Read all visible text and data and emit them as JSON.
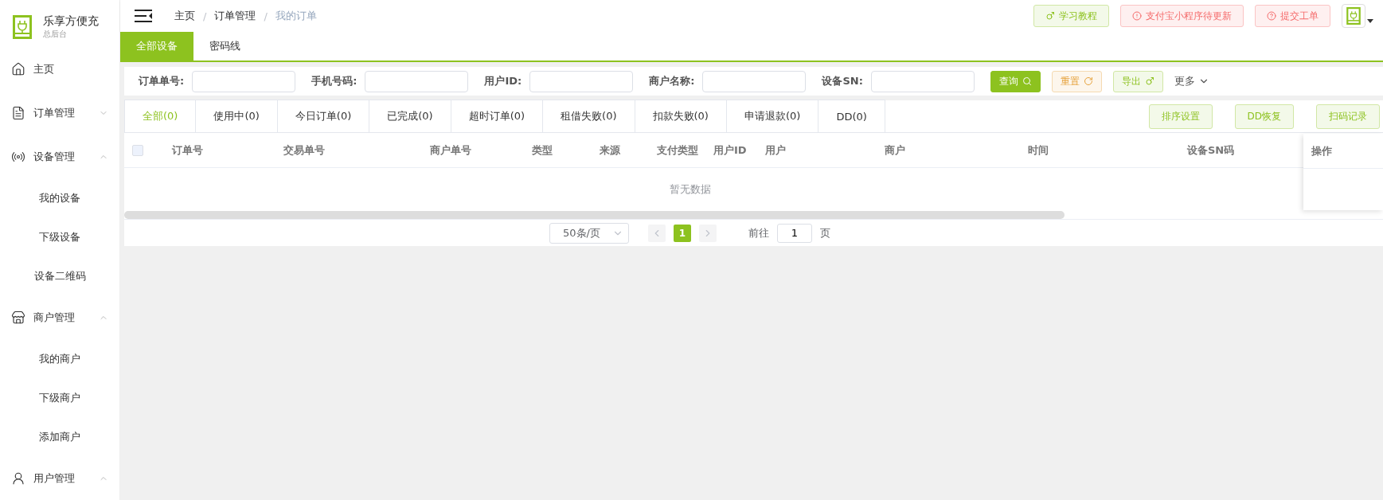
{
  "brand": {
    "name": "乐享方便充",
    "subtitle": "总后台"
  },
  "sidebar": {
    "items": [
      {
        "label": "主页",
        "kind": "link"
      },
      {
        "label": "订单管理",
        "kind": "group",
        "expanded": false
      },
      {
        "label": "设备管理",
        "kind": "group",
        "expanded": true,
        "children": [
          {
            "label": "我的设备"
          },
          {
            "label": "下级设备"
          },
          {
            "label": "设备二维码"
          }
        ]
      },
      {
        "label": "商户管理",
        "kind": "group",
        "expanded": true,
        "children": [
          {
            "label": "我的商户"
          },
          {
            "label": "下级商户"
          },
          {
            "label": "添加商户"
          }
        ]
      },
      {
        "label": "用户管理",
        "kind": "group",
        "expanded": true
      }
    ]
  },
  "breadcrumbs": [
    {
      "label": "主页",
      "current": false
    },
    {
      "separator": "/",
      "label": "订单管理",
      "current": false
    },
    {
      "separator": "/",
      "label": "我的订单",
      "current": true
    }
  ],
  "header_buttons": [
    {
      "label": "学习教程",
      "kind": "tutorial"
    },
    {
      "label": "支付宝小程序待更新",
      "kind": "alert"
    },
    {
      "label": "提交工单",
      "kind": "help"
    }
  ],
  "page_tabs": [
    {
      "label": "全部设备",
      "selected": true
    },
    {
      "label": "密码线",
      "selected": false
    }
  ],
  "filters": [
    {
      "label": "订单单号:"
    },
    {
      "label": "手机号码:"
    },
    {
      "label": "用户ID:"
    },
    {
      "label": "商户名称:"
    },
    {
      "label": "设备SN:"
    }
  ],
  "filter_actions": [
    {
      "label": "查询",
      "kind": "primary"
    },
    {
      "label": "重置",
      "kind": "warning"
    },
    {
      "label": "导出",
      "kind": "plain"
    }
  ],
  "more": "更多",
  "status_tabs": [
    {
      "label": "全部(0)",
      "selected": true
    },
    {
      "label": "使用中(0)",
      "selected": false
    },
    {
      "label": "今日订单(0)",
      "selected": false
    },
    {
      "label": "已完成(0)",
      "selected": false
    },
    {
      "label": "超时订单(0)",
      "selected": false
    },
    {
      "label": "租借失败(0)",
      "selected": false
    },
    {
      "label": "扣款失败(0)",
      "selected": false
    },
    {
      "label": "申请退款(0)",
      "selected": false
    },
    {
      "label": "DD(0)",
      "selected": false
    }
  ],
  "table_actions": [
    {
      "label": "排序设置"
    },
    {
      "label": "DD恢复"
    },
    {
      "label": "扫码记录"
    }
  ],
  "table": {
    "select_all": false,
    "columns": [
      "订单号",
      "交易单号",
      "商户单号",
      "类型",
      "来源",
      "支付类型",
      "用户ID",
      "用户",
      "商户",
      "时间",
      "设备SN码"
    ],
    "fixed_column": "操作",
    "empty_text": "暂无数据"
  },
  "pagination": {
    "page_size": "50条/页",
    "pages": [
      {
        "label": "1",
        "selected": true
      }
    ],
    "goto_label": "前往",
    "goto_value": "1",
    "goto_suffix": "页"
  }
}
